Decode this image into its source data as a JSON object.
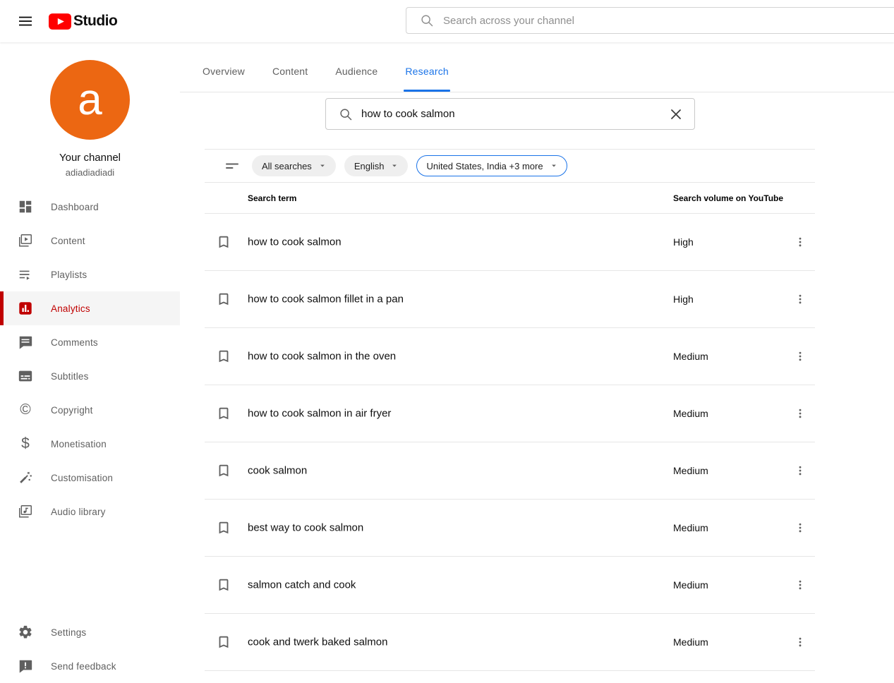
{
  "header": {
    "brand": "Studio",
    "search_placeholder": "Search across your channel"
  },
  "sidebar": {
    "avatar_letter": "a",
    "channel_label": "Your channel",
    "channel_name": "adiadiadiadi",
    "items": [
      {
        "label": "Dashboard",
        "icon": "dashboard-icon",
        "active": false
      },
      {
        "label": "Content",
        "icon": "content-icon",
        "active": false
      },
      {
        "label": "Playlists",
        "icon": "playlists-icon",
        "active": false
      },
      {
        "label": "Analytics",
        "icon": "analytics-icon",
        "active": true
      },
      {
        "label": "Comments",
        "icon": "comments-icon",
        "active": false
      },
      {
        "label": "Subtitles",
        "icon": "subtitles-icon",
        "active": false
      },
      {
        "label": "Copyright",
        "icon": "copyright-icon",
        "active": false
      },
      {
        "label": "Monetisation",
        "icon": "monetisation-icon",
        "active": false
      },
      {
        "label": "Customisation",
        "icon": "customisation-icon",
        "active": false
      },
      {
        "label": "Audio library",
        "icon": "audio-library-icon",
        "active": false
      }
    ],
    "footer_items": [
      {
        "label": "Settings",
        "icon": "settings-icon"
      },
      {
        "label": "Send feedback",
        "icon": "send-feedback-icon"
      }
    ]
  },
  "main": {
    "tabs": [
      {
        "label": "Overview",
        "active": false
      },
      {
        "label": "Content",
        "active": false
      },
      {
        "label": "Audience",
        "active": false
      },
      {
        "label": "Research",
        "active": true
      }
    ],
    "search": {
      "value": "how to cook salmon",
      "clear_icon": "close-icon"
    },
    "filters": {
      "filter_icon": "filter-icon",
      "chips": [
        {
          "label": "All searches",
          "selected": false
        },
        {
          "label": "English",
          "selected": false
        },
        {
          "label": "United States, India +3 more",
          "selected": true
        }
      ]
    },
    "table": {
      "columns": {
        "term": "Search term",
        "volume": "Search volume on YouTube"
      },
      "rows": [
        {
          "term": "how to cook salmon",
          "volume": "High"
        },
        {
          "term": "how to cook salmon fillet in a pan",
          "volume": "High"
        },
        {
          "term": "how to cook salmon in the oven",
          "volume": "Medium"
        },
        {
          "term": "how to cook salmon in air fryer",
          "volume": "Medium"
        },
        {
          "term": "cook salmon",
          "volume": "Medium"
        },
        {
          "term": "best way to cook salmon",
          "volume": "Medium"
        },
        {
          "term": "salmon catch and cook",
          "volume": "Medium"
        },
        {
          "term": "cook and twerk baked salmon",
          "volume": "Medium"
        }
      ]
    }
  },
  "colors": {
    "brand_red": "#ff0000",
    "active_red": "#c00000",
    "accent_blue": "#1a73e8",
    "avatar_orange": "#ec6712",
    "text_gray": "#606060"
  }
}
